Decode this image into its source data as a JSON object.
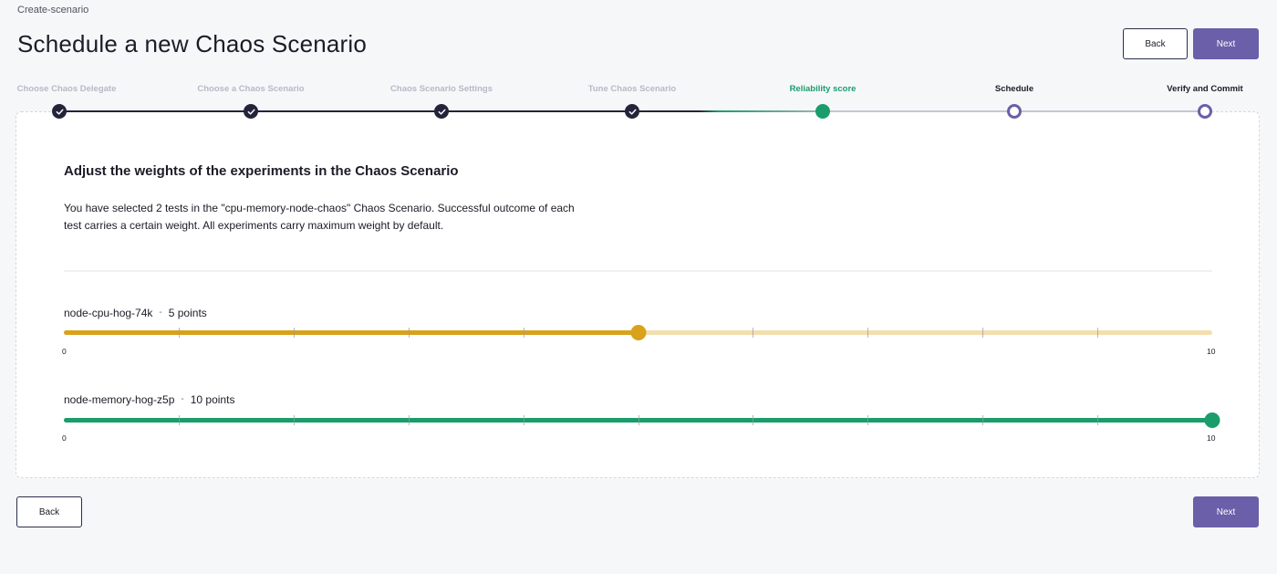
{
  "breadcrumb": "Create-scenario",
  "page_title": "Schedule a new Chaos Scenario",
  "header_actions": {
    "back_label": "Back",
    "next_label": "Next"
  },
  "footer_actions": {
    "back_label": "Back",
    "next_label": "Next"
  },
  "colors": {
    "accent": "#6a5fa8",
    "success": "#1a9d6a",
    "warning": "#d9a21b",
    "dark": "#23243a"
  },
  "stepper": {
    "steps": [
      {
        "label": "Choose Chaos Delegate",
        "state": "done"
      },
      {
        "label": "Choose a Chaos Scenario",
        "state": "done"
      },
      {
        "label": "Chaos Scenario Settings",
        "state": "done"
      },
      {
        "label": "Tune Chaos Scenario",
        "state": "done"
      },
      {
        "label": "Reliability score",
        "state": "active"
      },
      {
        "label": "Schedule",
        "state": "todo"
      },
      {
        "label": "Verify and Commit",
        "state": "todo"
      }
    ]
  },
  "card": {
    "title": "Adjust the weights of the experiments in the Chaos Scenario",
    "description": "You have selected 2 tests in the \"cpu-memory-node-chaos\" Chaos Scenario. Successful outcome of each test carries a certain weight. All experiments carry maximum weight by default."
  },
  "experiments": [
    {
      "name": "node-cpu-hog-74k",
      "separator": "-",
      "points_label": "5 points",
      "value": 5,
      "min": 0,
      "max": 10,
      "min_label": "0",
      "max_label": "10",
      "color": "#d9a21b",
      "track_color": "#f3deae"
    },
    {
      "name": "node-memory-hog-z5p",
      "separator": "-",
      "points_label": "10 points",
      "value": 10,
      "min": 0,
      "max": 10,
      "min_label": "0",
      "max_label": "10",
      "color": "#1a9d6a",
      "track_color": "#bfe6d5"
    }
  ]
}
